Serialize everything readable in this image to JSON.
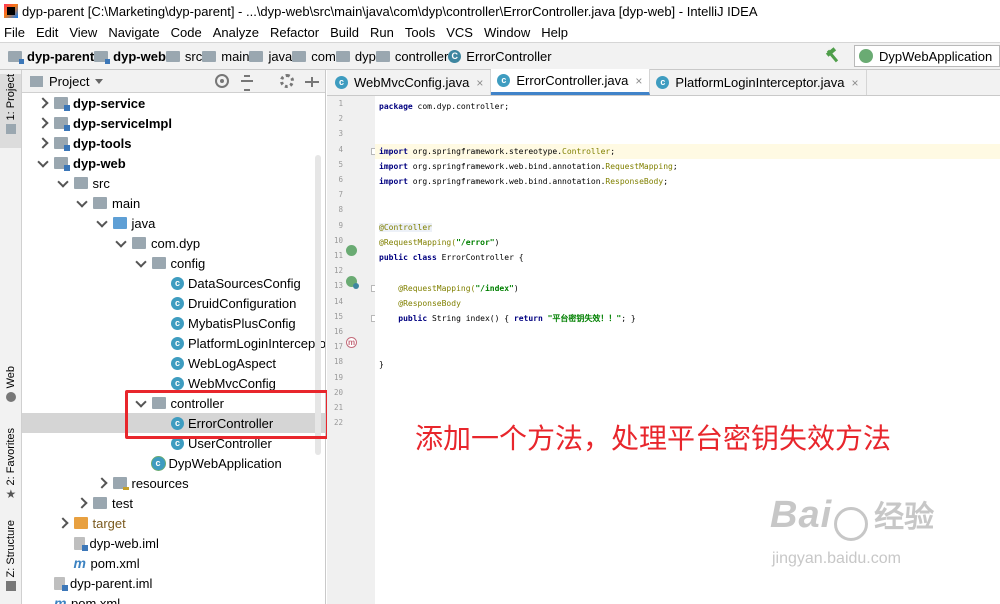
{
  "window": {
    "title": "dyp-parent [C:\\Marketing\\dyp-parent] - ...\\dyp-web\\src\\main\\java\\com\\dyp\\controller\\ErrorController.java [dyp-web] - IntelliJ IDEA"
  },
  "menu": [
    "File",
    "Edit",
    "View",
    "Navigate",
    "Code",
    "Analyze",
    "Refactor",
    "Build",
    "Run",
    "Tools",
    "VCS",
    "Window",
    "Help"
  ],
  "breadcrumbs": [
    {
      "label": "dyp-parent",
      "bold": true,
      "icon": "module-folder-icon"
    },
    {
      "label": "dyp-web",
      "bold": true,
      "icon": "module-folder-icon"
    },
    {
      "label": "src",
      "bold": false,
      "icon": "folder-icon"
    },
    {
      "label": "main",
      "bold": false,
      "icon": "folder-icon"
    },
    {
      "label": "java",
      "bold": false,
      "icon": "folder-icon"
    },
    {
      "label": "com",
      "bold": false,
      "icon": "folder-icon"
    },
    {
      "label": "dyp",
      "bold": false,
      "icon": "folder-icon"
    },
    {
      "label": "controller",
      "bold": false,
      "icon": "folder-icon"
    },
    {
      "label": "ErrorController",
      "bold": false,
      "icon": "class-icon"
    }
  ],
  "run_config": {
    "label": "DypWebApplication"
  },
  "left_stripe": {
    "project": "1: Project",
    "web": "Web",
    "favorites": "2: Favorites",
    "structure": "Z: Structure"
  },
  "project_panel": {
    "title": "Project",
    "tree": [
      {
        "label": "dyp-service",
        "indent": 0,
        "arrow": "right",
        "icon": "module",
        "bold": true
      },
      {
        "label": "dyp-serviceImpl",
        "indent": 0,
        "arrow": "right",
        "icon": "module",
        "bold": true
      },
      {
        "label": "dyp-tools",
        "indent": 0,
        "arrow": "right",
        "icon": "module",
        "bold": true
      },
      {
        "label": "dyp-web",
        "indent": 0,
        "arrow": "down",
        "icon": "module",
        "bold": true
      },
      {
        "label": "src",
        "indent": 1,
        "arrow": "down",
        "icon": "folder"
      },
      {
        "label": "main",
        "indent": 2,
        "arrow": "down",
        "icon": "folder"
      },
      {
        "label": "java",
        "indent": 3,
        "arrow": "down",
        "icon": "src"
      },
      {
        "label": "com.dyp",
        "indent": 4,
        "arrow": "down",
        "icon": "folder"
      },
      {
        "label": "config",
        "indent": 5,
        "arrow": "down",
        "icon": "folder"
      },
      {
        "label": "DataSourcesConfig",
        "indent": 6,
        "arrow": "none",
        "icon": "class"
      },
      {
        "label": "DruidConfiguration",
        "indent": 6,
        "arrow": "none",
        "icon": "class"
      },
      {
        "label": "MybatisPlusConfig",
        "indent": 6,
        "arrow": "none",
        "icon": "class"
      },
      {
        "label": "PlatformLoginIntercepto",
        "indent": 6,
        "arrow": "none",
        "icon": "class"
      },
      {
        "label": "WebLogAspect",
        "indent": 6,
        "arrow": "none",
        "icon": "class"
      },
      {
        "label": "WebMvcConfig",
        "indent": 6,
        "arrow": "none",
        "icon": "class"
      },
      {
        "label": "controller",
        "indent": 5,
        "arrow": "down",
        "icon": "folder"
      },
      {
        "label": "ErrorController",
        "indent": 6,
        "arrow": "none",
        "icon": "class",
        "selected": true
      },
      {
        "label": "UserController",
        "indent": 6,
        "arrow": "none",
        "icon": "class"
      },
      {
        "label": "DypWebApplication",
        "indent": 5,
        "arrow": "none",
        "icon": "app"
      },
      {
        "label": "resources",
        "indent": 3,
        "arrow": "right",
        "icon": "res"
      },
      {
        "label": "test",
        "indent": 2,
        "arrow": "right",
        "icon": "test"
      },
      {
        "label": "target",
        "indent": 1,
        "arrow": "right",
        "icon": "target"
      },
      {
        "label": "dyp-web.iml",
        "indent": 1,
        "arrow": "none",
        "icon": "iml"
      },
      {
        "label": "pom.xml",
        "indent": 1,
        "arrow": "none",
        "icon": "maven"
      },
      {
        "label": "dyp-parent.iml",
        "indent": 0,
        "arrow": "none",
        "icon": "iml"
      },
      {
        "label": "pom.xml",
        "indent": 0,
        "arrow": "none",
        "icon": "maven"
      }
    ]
  },
  "tabs": [
    {
      "label": "WebMvcConfig.java",
      "active": false
    },
    {
      "label": "ErrorController.java",
      "active": true
    },
    {
      "label": "PlatformLoginInterceptor.java",
      "active": false
    }
  ],
  "code": {
    "line_numbers": [
      "1",
      "2",
      "3",
      "4",
      "5",
      "6",
      "7",
      "8",
      "9",
      "10",
      "11",
      "12",
      "13",
      "14",
      "15",
      "16",
      "17",
      "18",
      "19",
      "20",
      "21",
      "22"
    ],
    "package_kw": "package",
    "package_name": " com.dyp.controller;",
    "imports": [
      {
        "kw": "import",
        "path": " org.springframework.stereotype.",
        "cls": "Controller",
        "end": ";"
      },
      {
        "kw": "import",
        "path": " org.springframework.web.bind.annotation.",
        "cls": "RequestMapping",
        "end": ";"
      },
      {
        "kw": "import",
        "path": " org.springframework.web.bind.annotation.",
        "cls": "ResponseBody",
        "end": ";"
      }
    ],
    "ann_controller": "@Controller",
    "ann_request_mapping": "@RequestMapping(",
    "str_error": "\"/error\"",
    "close_paren": ")",
    "class_kw1": "public",
    "class_kw2": "class",
    "class_decl": " ErrorController {",
    "m_request_mapping": "    @RequestMapping(",
    "str_index": "\"/index\"",
    "m_response_body": "    @ResponseBody",
    "m_kw1": "    public",
    "m_sig": " String index() { ",
    "m_kw2": "return",
    "m_str": "\"平台密钥失效！！\"",
    "m_end": "; }",
    "class_close": "}"
  },
  "annotation_text": "添加一个方法，处理平台密钥失效方法",
  "watermark": {
    "brand": "Bai",
    "brand2": "经验",
    "url": "jingyan.baidu.com"
  },
  "colors": {
    "highlight": "#e8262c",
    "tab_active": "#4083c9"
  }
}
